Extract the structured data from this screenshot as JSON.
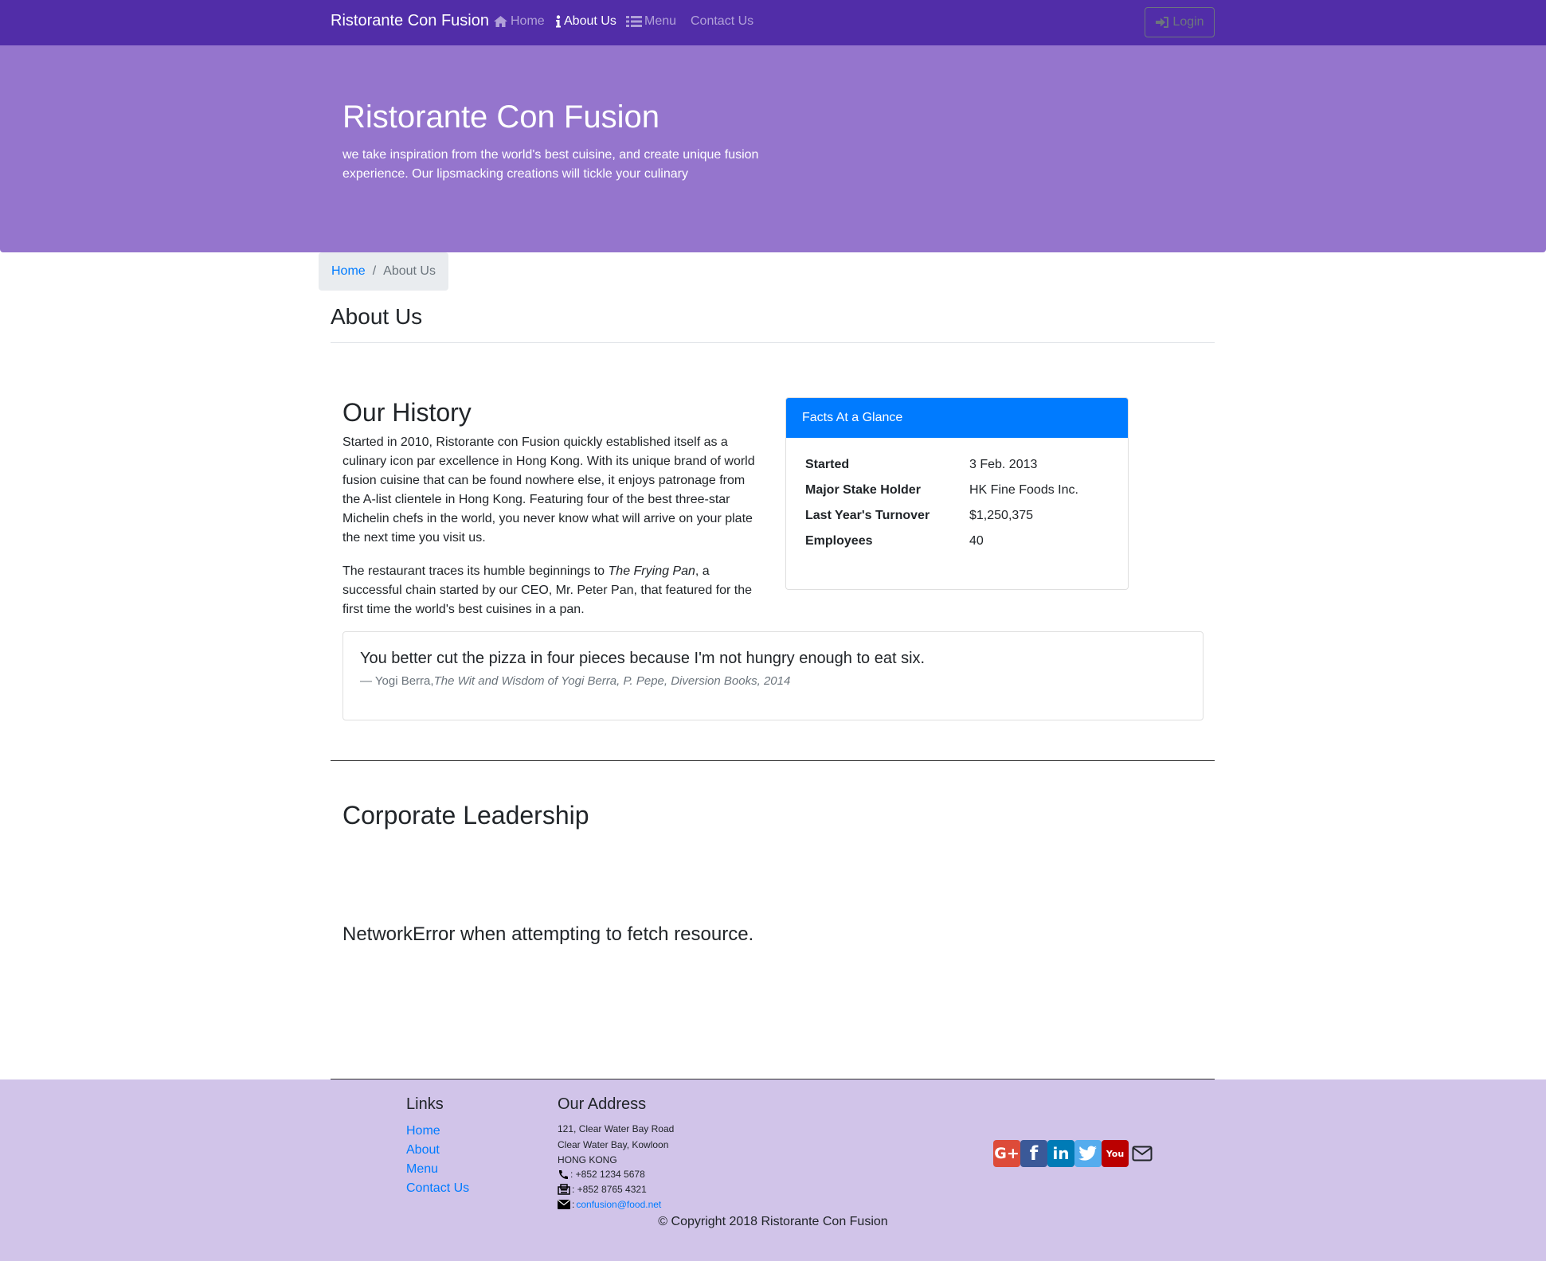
{
  "navbar": {
    "brand": "Ristorante Con Fusion",
    "links": [
      {
        "label": "Home",
        "icon": "home-icon"
      },
      {
        "label": "About Us",
        "icon": "info-icon"
      },
      {
        "label": "Menu",
        "icon": "list-icon"
      },
      {
        "label": "Contact Us",
        "icon": "address-card-icon"
      }
    ],
    "login_label": "Login"
  },
  "jumbotron": {
    "title": "Ristorante Con Fusion",
    "text": "we take inspiration from the world's best cuisine, and create unique fusion experience. Our lipsmacking creations will tickle your culinary"
  },
  "breadcrumb": {
    "home": "Home",
    "current": "About Us"
  },
  "page_title": "About Us",
  "history": {
    "title": "Our History",
    "p1": "Started in 2010, Ristorante con Fusion quickly established itself as a culinary icon par excellence in Hong Kong. With its unique brand of world fusion cuisine that can be found nowhere else, it enjoys patronage from the A-list clientele in Hong Kong. Featuring four of the best three-star Michelin chefs in the world, you never know what will arrive on your plate the next time you visit us.",
    "p2_pre": "The restaurant traces its humble beginnings to ",
    "p2_em": "The Frying Pan",
    "p2_post": ", a successful chain started by our CEO, Mr. Peter Pan, that featured for the first time the world's best cuisines in a pan."
  },
  "facts": {
    "header": "Facts At a Glance",
    "rows": [
      {
        "label": "Started",
        "value": "3 Feb. 2013"
      },
      {
        "label": "Major Stake Holder",
        "value": "HK Fine Foods Inc."
      },
      {
        "label": "Last Year's Turnover",
        "value": "$1,250,375"
      },
      {
        "label": "Employees",
        "value": "40"
      }
    ]
  },
  "quote": {
    "text": "You better cut the pizza in four pieces because I'm not hungry enough to eat six.",
    "author": "— Yogi Berra,",
    "source": "The Wit and Wisdom of Yogi Berra, P. Pepe, Diversion Books, 2014"
  },
  "leadership": {
    "title": "Corporate Leadership",
    "error": "NetworkError when attempting to fetch resource."
  },
  "footer": {
    "links_title": "Links",
    "links": [
      "Home",
      "About",
      "Menu",
      "Contact Us"
    ],
    "address_title": "Our Address",
    "address": [
      "121, Clear Water Bay Road",
      "Clear Water Bay, Kowloon",
      "HONG KONG"
    ],
    "phone": ": +852 1234 5678",
    "fax": ": +852 8765 4321",
    "email_prefix": ": ",
    "email": "confusion@food.net",
    "copyright": "© Copyright 2018 Ristorante Con Fusion",
    "social": [
      {
        "name": "google-plus-icon",
        "glyph": "G+",
        "color": "#dd4b39"
      },
      {
        "name": "facebook-icon",
        "glyph": "f",
        "color": "#3b5998"
      },
      {
        "name": "linkedin-icon",
        "glyph": "in",
        "color": "#007bb6"
      },
      {
        "name": "twitter-icon",
        "glyph": "t",
        "color": "#55acee"
      },
      {
        "name": "youtube-icon",
        "glyph": "You",
        "color": "#bb0000"
      }
    ]
  }
}
